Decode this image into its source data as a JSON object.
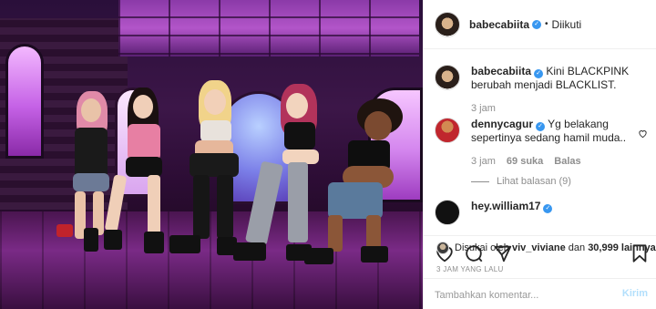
{
  "post": {
    "image_alt": "",
    "colors": {
      "accent": "#3897f0",
      "muted": "#8e8e8e",
      "post_button_disabled": "#b2dffc"
    }
  },
  "header": {
    "username": "babecabiita",
    "verified_icon": "verified-badge-icon",
    "separator": "•",
    "follow_state": "Diikuti"
  },
  "caption": {
    "username": "babecabiita",
    "text": "Kini BLACKPINK berubah menjadi BLACKLIST.",
    "time": "3 jam"
  },
  "comments": [
    {
      "username": "dennycagur",
      "text": "Yg belakang sepertinya sedang hamil muda..",
      "time": "3 jam",
      "likes": "69 suka",
      "reply_label": "Balas",
      "view_replies": "Lihat balasan (9)"
    },
    {
      "username": "hey.william17"
    }
  ],
  "actions": {
    "like_icon": "heart-icon",
    "comment_icon": "comment-icon",
    "share_icon": "share-icon",
    "save_icon": "bookmark-icon"
  },
  "likes": {
    "prefix": "Disukai oleh",
    "user": "viv_viviane",
    "middle": "dan",
    "count": "30,999 lainnya"
  },
  "timestamp": "3 JAM YANG LALU",
  "comment_box": {
    "placeholder": "Tambahkan komentar...",
    "post_label": "Kirim"
  }
}
